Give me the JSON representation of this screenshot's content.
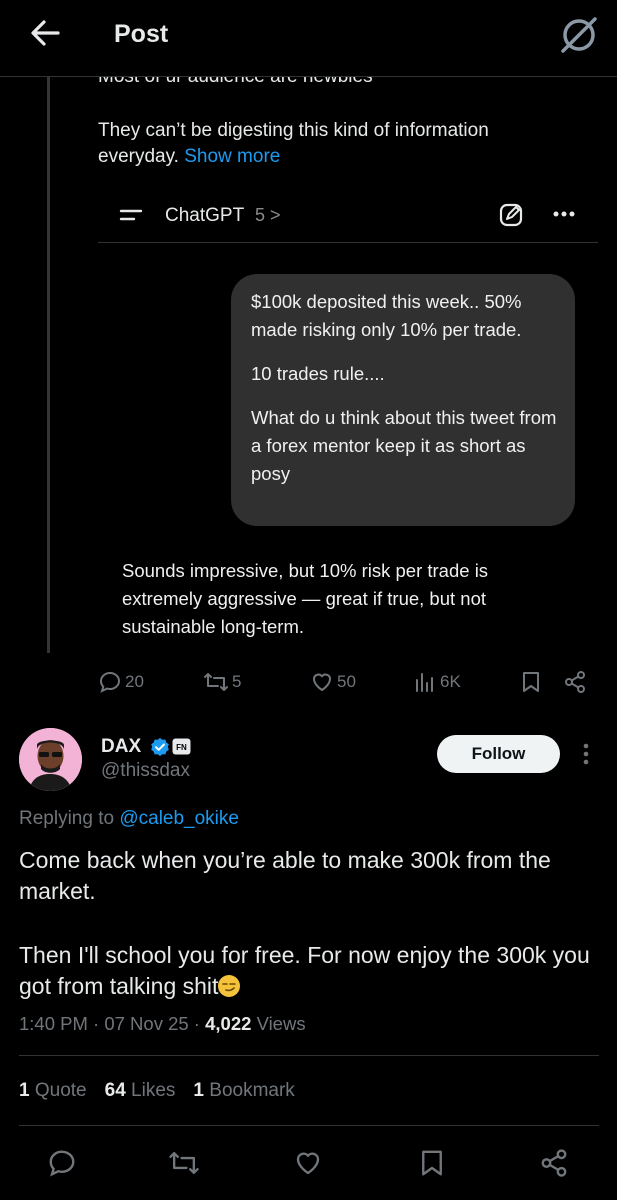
{
  "header": {
    "title": "Post"
  },
  "quoted": {
    "cut_text": "Most of ur audience are newbies",
    "paragraph": "They can’t be digesting this kind of information everyday.",
    "show_more": "Show more",
    "chatgpt": {
      "name": "ChatGPT",
      "version": "5 >"
    },
    "bubble": {
      "line1": "$100k deposited this week.. 50% made risking only 10% per trade.",
      "line2": "10 trades rule....",
      "line3": "What do u think about this tweet from a forex mentor keep it as short as posy"
    },
    "ai_reply": "Sounds impressive, but 10% risk per trade is extremely aggressive — great if true, but not sustainable long-term.",
    "actions": {
      "replies": "20",
      "reposts": "5",
      "likes": "50",
      "views": "6K"
    }
  },
  "post": {
    "name": "DAX",
    "badge": "FN",
    "handle": "@thissdax",
    "follow_label": "Follow",
    "replying_prefix": "Replying to",
    "replying_to": "@caleb_okike",
    "body1": "Come back when you’re able to make 300k from the market.",
    "body2": "Then I'll school you for free.  For now enjoy the 300k you got from talking shit",
    "time": "1:40 PM · 07 Nov 25 ·",
    "views_count": "4,022",
    "views_label": "Views",
    "stats": {
      "quotes_count": "1",
      "quotes_label": "Quote",
      "likes_count": "64",
      "likes_label": "Likes",
      "bookmarks_count": "1",
      "bookmarks_label": "Bookmark"
    }
  },
  "colors": {
    "accent": "#1d9bf0",
    "background": "#000000",
    "bubble": "#303030"
  }
}
